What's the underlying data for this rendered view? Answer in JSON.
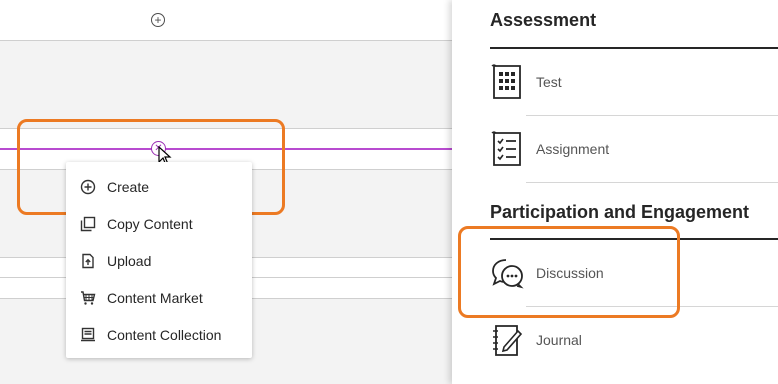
{
  "menu": {
    "items": [
      {
        "label": "Create",
        "icon": "plus-circle-icon"
      },
      {
        "label": "Copy Content",
        "icon": "copy-icon"
      },
      {
        "label": "Upload",
        "icon": "upload-icon"
      },
      {
        "label": "Content Market",
        "icon": "cart-icon"
      },
      {
        "label": "Content Collection",
        "icon": "collection-icon"
      }
    ]
  },
  "panel": {
    "assessment_title": "Assessment",
    "participation_title": "Participation and Engagement",
    "items": [
      {
        "label": "Test",
        "icon": "test-icon"
      },
      {
        "label": "Assignment",
        "icon": "assignment-icon"
      },
      {
        "label": "Discussion",
        "icon": "discussion-icon"
      },
      {
        "label": "Journal",
        "icon": "journal-icon"
      }
    ]
  },
  "colors": {
    "highlight": "#ec7a23",
    "insert_line": "#b84bd0"
  }
}
